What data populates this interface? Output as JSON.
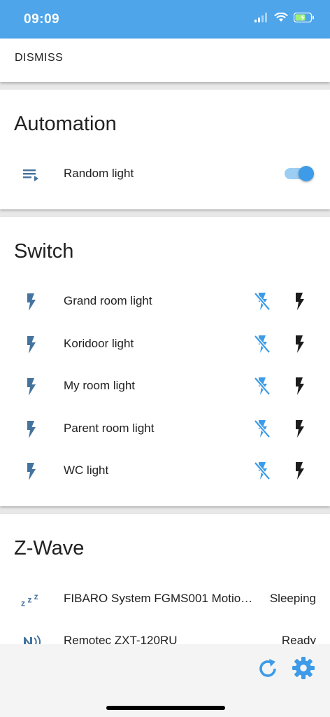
{
  "status": {
    "time": "09:09"
  },
  "dismiss": {
    "label": "DISMISS"
  },
  "automation": {
    "title": "Automation",
    "items": [
      {
        "label": "Random light",
        "icon": "playlist-play-icon",
        "enabled": true
      }
    ]
  },
  "switch": {
    "title": "Switch",
    "items": [
      {
        "label": "Grand room light",
        "icon": "flash-icon"
      },
      {
        "label": "Koridoor light",
        "icon": "flash-icon"
      },
      {
        "label": "My room light",
        "icon": "flash-icon"
      },
      {
        "label": "Parent room light",
        "icon": "flash-icon"
      },
      {
        "label": "WC light",
        "icon": "flash-icon"
      }
    ]
  },
  "zwave": {
    "title": "Z-Wave",
    "items": [
      {
        "label": "FIBARO System FGMS001 Motio…",
        "state": "Sleeping",
        "icon": "sleep-icon"
      },
      {
        "label": "Remotec ZXT-120RU",
        "state": "Ready",
        "icon": "nfc-signal-icon"
      }
    ]
  },
  "colors": {
    "accent": "#4ea5ea",
    "toggle_on": "#3d9be8",
    "icon_blue": "#44739e",
    "text": "#212121"
  }
}
